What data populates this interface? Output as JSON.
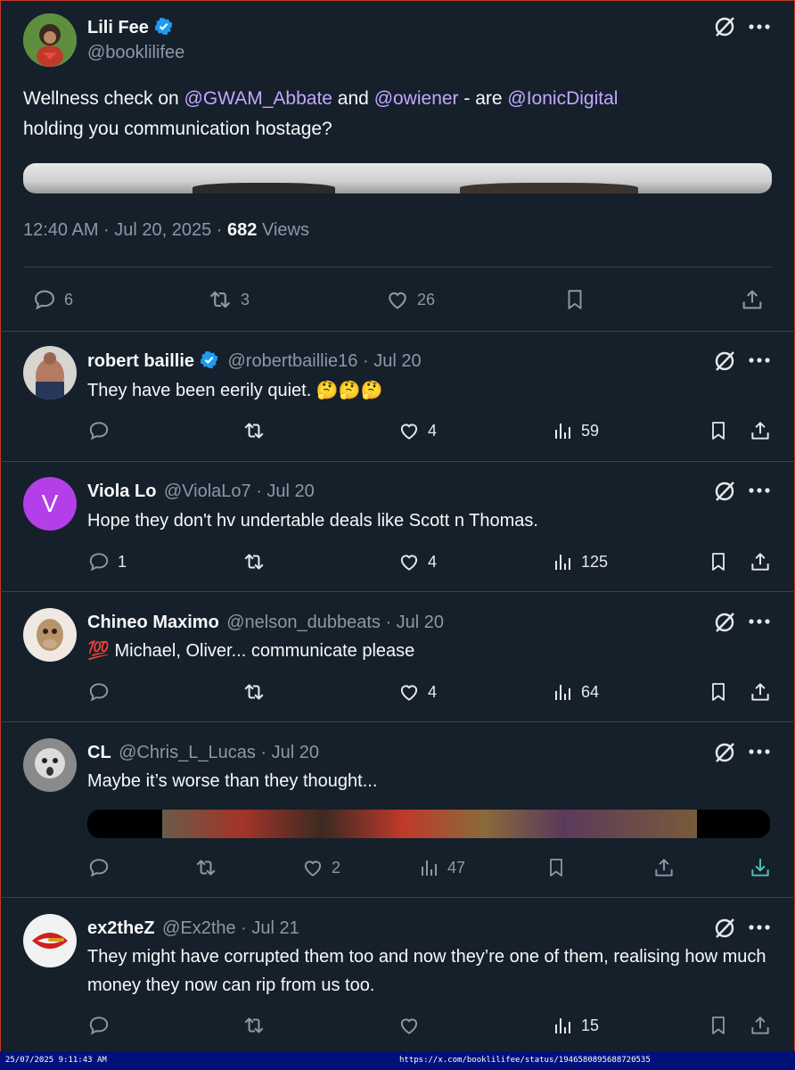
{
  "main_post": {
    "author_name": "Lili Fee",
    "author_handle": "@booklilifee",
    "text_before": "Wellness check on ",
    "mention_1": "@GWAM_Abbate",
    "text_and": " and ",
    "mention_2": "@owiener",
    "text_mid": " - are ",
    "mention_3": "@IonicDigital",
    "text_after": "holding you communication hostage?",
    "timestamp": "12:40 AM · Jul 20, 2025 · ",
    "views_count": "682",
    "views_label": " Views",
    "replies": "6",
    "reposts": "3",
    "likes": "26"
  },
  "replies": [
    {
      "name": "robert baillie",
      "handle": "@robertbaillie16 · Jul 20",
      "text": "They have been eerily quiet. 🤔🤔🤔",
      "replies": "",
      "reposts": "",
      "likes": "4",
      "views": "59"
    },
    {
      "name": "Viola Lo",
      "handle": "@ViolaLo7 · Jul 20",
      "avatar_letter": "V",
      "text": "Hope they don't hv undertable deals like Scott n Thomas.",
      "replies": "1",
      "reposts": "",
      "likes": "4",
      "views": "125"
    },
    {
      "name": "Chineo Maximo",
      "handle": "@nelson_dubbeats · Jul 20",
      "text": "💯 Michael, Oliver... communicate please",
      "replies": "",
      "reposts": "",
      "likes": "4",
      "views": "64"
    },
    {
      "name": "CL",
      "handle": "@Chris_L_Lucas · Jul 20",
      "text": "Maybe it’s worse than they thought...",
      "replies": "",
      "reposts": "",
      "likes": "2",
      "views": "47"
    },
    {
      "name": "ex2theZ",
      "handle": "@Ex2the · Jul 21",
      "text": "They might have corrupted them too and now they’re one of them, realising how much money they now can rip from us too.",
      "replies": "",
      "reposts": "",
      "likes": "",
      "views": "15"
    }
  ],
  "status_bar": {
    "datetime": "25/07/2025 9:11:43 AM",
    "url": "https://x.com/booklilifee/status/1946580895688720535"
  },
  "colors": {
    "background": "#15202b",
    "mention": "#c3a7ff",
    "verified": "#1d9bf0",
    "muted": "#8b98a5",
    "status_bar": "#02117a"
  },
  "icons": [
    "grok-icon",
    "more-icon",
    "verified-badge-icon",
    "reply-icon",
    "repost-icon",
    "like-icon",
    "views-icon",
    "bookmark-icon",
    "share-icon",
    "download-icon"
  ]
}
